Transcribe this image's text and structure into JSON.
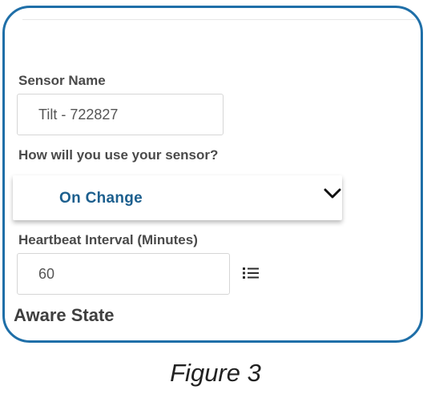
{
  "form": {
    "sensor_name_label": "Sensor Name",
    "sensor_name_value": "Tilt - 722827",
    "use_label": "How will you use your sensor?",
    "use_selected": "On Change",
    "heartbeat_label": "Heartbeat Interval (Minutes)",
    "heartbeat_value": "60",
    "aware_state_heading": "Aware State"
  },
  "icons": {
    "dropdown": "chevron-down-icon",
    "list": "list-icon"
  },
  "caption": "Figure 3",
  "colors": {
    "frame_border": "#1f6fa8",
    "selected_value": "#1c5f8e"
  }
}
